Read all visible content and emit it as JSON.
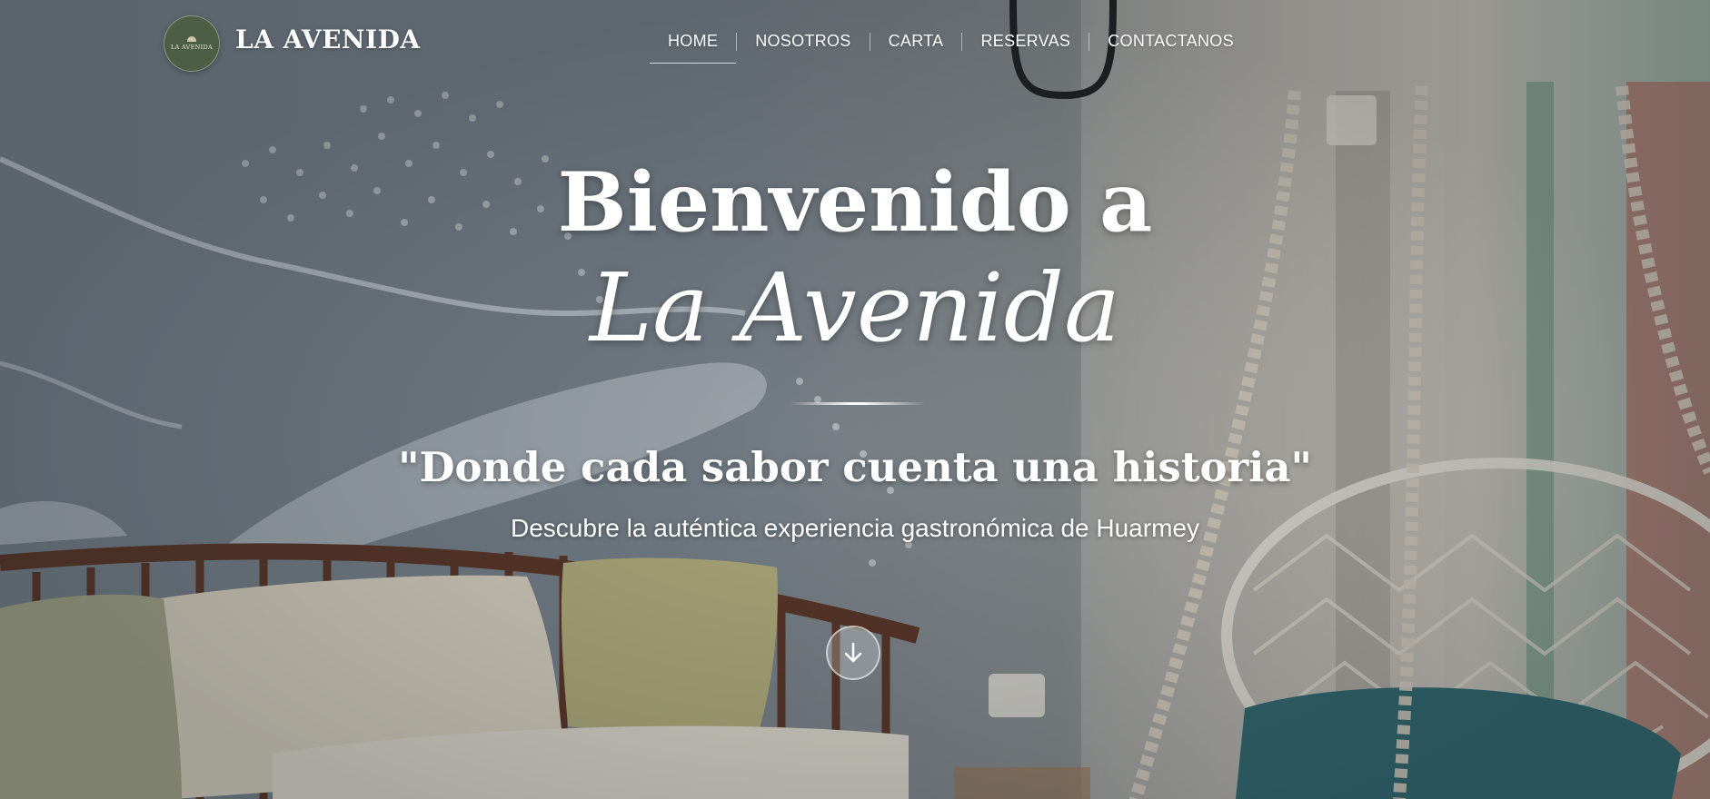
{
  "nav": {
    "logo_text": "LA AVENIDA",
    "brand": "LA AVENIDA",
    "items": [
      {
        "label": "HOME",
        "active": true
      },
      {
        "label": "NOSOTROS",
        "active": false
      },
      {
        "label": "CARTA",
        "active": false
      },
      {
        "label": "RESERVAS",
        "active": false
      },
      {
        "label": "CONTACTANOS",
        "active": false
      }
    ]
  },
  "hero": {
    "title_line1": "Bienvenido a",
    "title_line2": "La Avenida",
    "tagline": "\"Donde cada sabor cuenta una historia\"",
    "subtitle": "Descubre la auténtica experiencia gastronómica de Huarmey",
    "scroll_icon": "arrow-down-icon"
  },
  "colors": {
    "logo_bg": "#4c5f45",
    "text": "#ffffff",
    "wall": "#77828d"
  }
}
